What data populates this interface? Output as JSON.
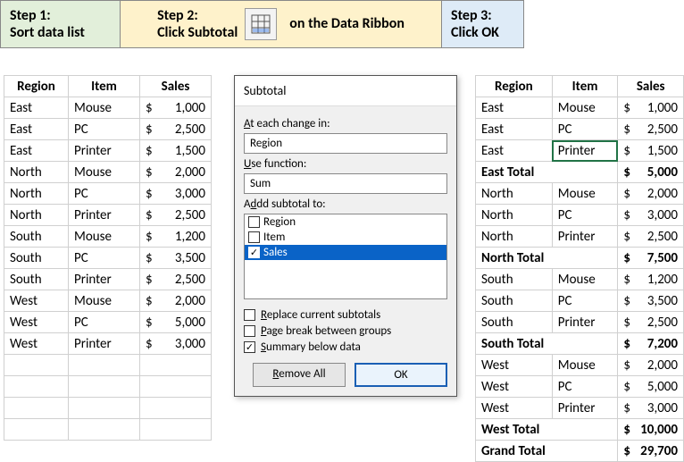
{
  "steps": {
    "s1_title": "Step 1:",
    "s1_text": "Sort data list",
    "s2_title": "Step 2:",
    "s2_left": "Click Subtotal",
    "s2_right": "on the Data Ribbon",
    "s3_title": "Step 3:",
    "s3_text": "Click OK"
  },
  "headers": {
    "region": "Region",
    "item": "Item",
    "sales": "Sales"
  },
  "left_rows": [
    {
      "region": "East",
      "item": "Mouse",
      "sales": "1,000"
    },
    {
      "region": "East",
      "item": "PC",
      "sales": "2,500"
    },
    {
      "region": "East",
      "item": "Printer",
      "sales": "1,500"
    },
    {
      "region": "North",
      "item": "Mouse",
      "sales": "2,000"
    },
    {
      "region": "North",
      "item": "PC",
      "sales": "3,000"
    },
    {
      "region": "North",
      "item": "Printer",
      "sales": "2,500"
    },
    {
      "region": "South",
      "item": "Mouse",
      "sales": "1,200"
    },
    {
      "region": "South",
      "item": "PC",
      "sales": "3,500"
    },
    {
      "region": "South",
      "item": "Printer",
      "sales": "2,500"
    },
    {
      "region": "West",
      "item": "Mouse",
      "sales": "2,000"
    },
    {
      "region": "West",
      "item": "PC",
      "sales": "5,000"
    },
    {
      "region": "West",
      "item": "Printer",
      "sales": "3,000"
    }
  ],
  "right_rows": [
    {
      "region": "East",
      "item": "Mouse",
      "sales": "1,000",
      "bold": false
    },
    {
      "region": "East",
      "item": "PC",
      "sales": "2,500",
      "bold": false
    },
    {
      "region": "East",
      "item": "Printer",
      "sales": "1,500",
      "bold": false,
      "active": true
    },
    {
      "region": "East Total",
      "item": "",
      "sales": "5,000",
      "bold": true
    },
    {
      "region": "North",
      "item": "Mouse",
      "sales": "2,000",
      "bold": false
    },
    {
      "region": "North",
      "item": "PC",
      "sales": "3,000",
      "bold": false
    },
    {
      "region": "North",
      "item": "Printer",
      "sales": "2,500",
      "bold": false
    },
    {
      "region": "North Total",
      "item": "",
      "sales": "7,500",
      "bold": true
    },
    {
      "region": "South",
      "item": "Mouse",
      "sales": "1,200",
      "bold": false
    },
    {
      "region": "South",
      "item": "PC",
      "sales": "3,500",
      "bold": false
    },
    {
      "region": "South",
      "item": "Printer",
      "sales": "2,500",
      "bold": false
    },
    {
      "region": "South Total",
      "item": "",
      "sales": "7,200",
      "bold": true
    },
    {
      "region": "West",
      "item": "Mouse",
      "sales": "2,000",
      "bold": false
    },
    {
      "region": "West",
      "item": "PC",
      "sales": "5,000",
      "bold": false
    },
    {
      "region": "West",
      "item": "Printer",
      "sales": "3,000",
      "bold": false
    },
    {
      "region": "West Total",
      "item": "",
      "sales": "10,000",
      "bold": true
    },
    {
      "region": "Grand Total",
      "item": "",
      "sales": "29,700",
      "bold": true
    }
  ],
  "dialog": {
    "title": "Subtotal",
    "at_each_label": "At each change in:",
    "at_each_value": "Region",
    "use_fn_label": "Use function:",
    "use_fn_value": "Sum",
    "add_sub_label": "Add subtotal to:",
    "list": [
      {
        "label": "Region",
        "checked": false,
        "selected": false
      },
      {
        "label": "Item",
        "checked": false,
        "selected": false
      },
      {
        "label": "Sales",
        "checked": true,
        "selected": true
      }
    ],
    "opt_replace": "Replace current subtotals",
    "opt_replace_checked": false,
    "opt_pagebreak": "Page break between groups",
    "opt_pagebreak_checked": false,
    "opt_summary": "Summary below data",
    "opt_summary_checked": true,
    "btn_remove": "Remove All",
    "btn_ok": "OK"
  }
}
